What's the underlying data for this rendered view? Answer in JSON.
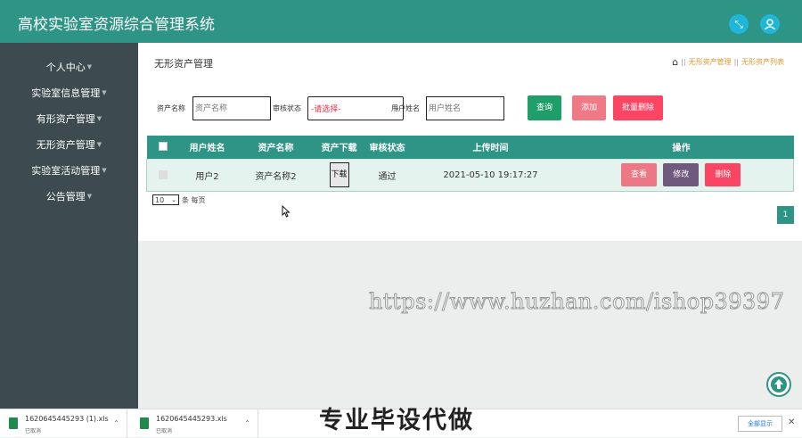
{
  "header": {
    "title": "高校实验室资源综合管理系统",
    "icon_fullscreen": "expand-icon",
    "icon_user": "user-icon"
  },
  "sidebar": {
    "items": [
      {
        "label": "个人中心"
      },
      {
        "label": "实验室信息管理"
      },
      {
        "label": "有形资产管理"
      },
      {
        "label": "无形资产管理"
      },
      {
        "label": "实验室活动管理"
      },
      {
        "label": "公告管理"
      }
    ]
  },
  "page": {
    "title": "无形资产管理",
    "breadcrumb": {
      "level1": "无形资产管理",
      "level2": "无形资产列表",
      "separator": "||"
    }
  },
  "filters": {
    "asset_name_label": "资产名称",
    "asset_name_placeholder": "资产名称",
    "status_label": "审核状态",
    "status_selected": "-请选择-",
    "user_name_label": "用户姓名",
    "user_name_placeholder": "用户姓名"
  },
  "buttons": {
    "query": "查询",
    "add": "添加",
    "batch_delete": "批量删除"
  },
  "table": {
    "headers": [
      "用户姓名",
      "资产名称",
      "资产下载",
      "审核状态",
      "上传时间",
      "操作"
    ],
    "rows": [
      {
        "user_name": "用户2",
        "asset_name": "资产名称2",
        "download": "下载",
        "status": "通过",
        "upload_time": "2021-05-10 19:17:27",
        "actions": {
          "view": "查看",
          "edit": "修改",
          "delete": "删除"
        }
      }
    ]
  },
  "pagination": {
    "page_size": "10",
    "per_page_label": "条 每页",
    "current_page": "1"
  },
  "watermark": "https://www.huzhan.com/ishop39397",
  "overlay_text": "专业毕设代做",
  "downloads": {
    "items": [
      {
        "file": "1620645445293 (1).xls",
        "status": "已取消"
      },
      {
        "file": "1620645445293.xls",
        "status": "已取消"
      }
    ],
    "show_all": "全部显示"
  },
  "colors": {
    "header": "#2e9586",
    "sidebar": "#3d4a4f",
    "query_button": "#1f9e6a",
    "add_button": "#ef7a86",
    "batch_delete_button": "#fb4563",
    "view_button": "#ed7784",
    "edit_button": "#6f5a7e",
    "delete_button": "#fb4563"
  }
}
